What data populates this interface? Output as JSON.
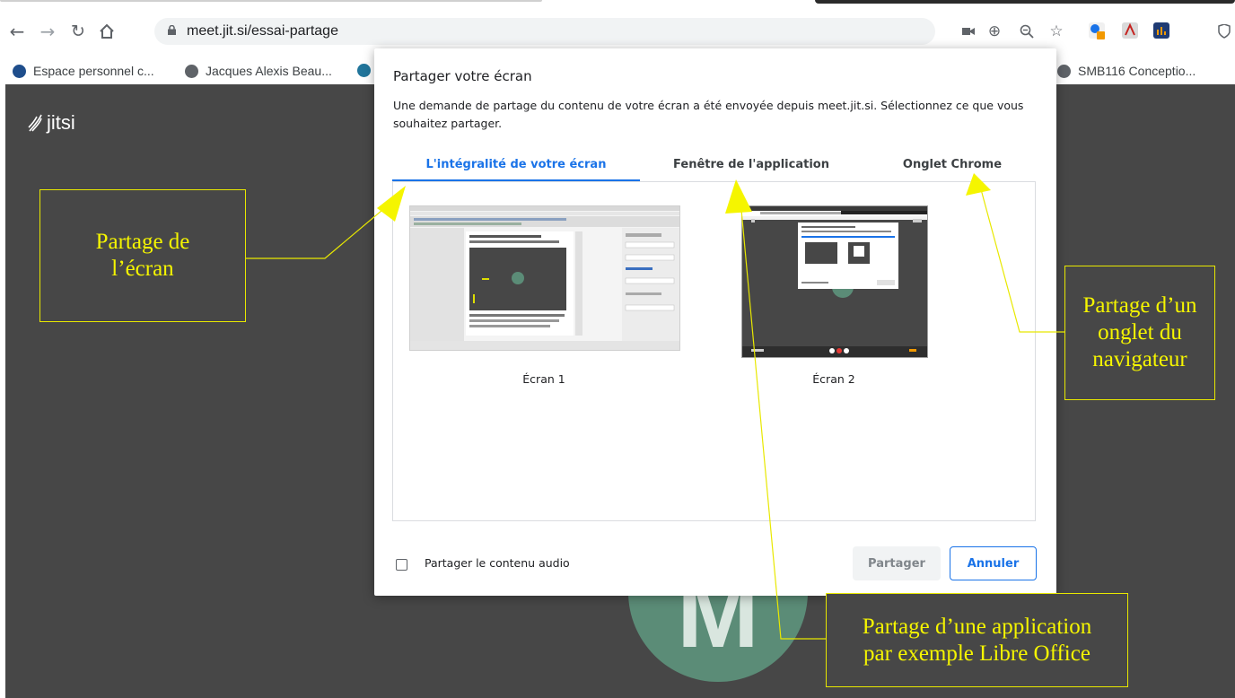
{
  "browser": {
    "url": "meet.jit.si/essai-partage",
    "bookmarks": [
      {
        "label": "Espace personnel c...",
        "icon": "site-e-icon"
      },
      {
        "label": "Jacques Alexis Beau...",
        "icon": "globe-icon"
      },
      {
        "label": "SMB116 Conceptio...",
        "icon": "globe-icon"
      }
    ]
  },
  "jitsi": {
    "logo_text": "jitsi",
    "avatar_letter": "M"
  },
  "dialog": {
    "title": "Partager votre écran",
    "description": "Une demande de partage du contenu de votre écran a été envoyée depuis meet.jit.si. Sélectionnez ce que vous souhaitez partager.",
    "tabs": [
      {
        "label": "L'intégralité de votre écran",
        "active": true
      },
      {
        "label": "Fenêtre de l'application",
        "active": false
      },
      {
        "label": "Onglet Chrome",
        "active": false
      }
    ],
    "screens": [
      {
        "label": "Écran 1"
      },
      {
        "label": "Écran 2"
      }
    ],
    "audio_label": "Partager le contenu audio",
    "share_label": "Partager",
    "cancel_label": "Annuler"
  },
  "annotations": {
    "screen": "Partage de\nl’écran",
    "tab": "Partage d’un\nonglet du\nnavigateur",
    "app": "Partage d’une application\npar exemple Libre Office"
  },
  "colors": {
    "accent": "#1a73e8",
    "page_bg": "#474747",
    "annotation": "#f5f500",
    "avatar": "#5b8c77"
  }
}
